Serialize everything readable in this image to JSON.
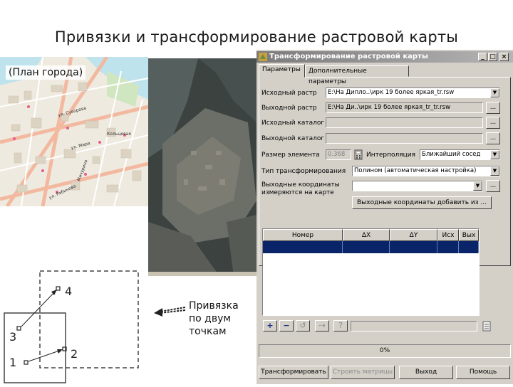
{
  "slide": {
    "title": "Привязки и трансформирование растровой карты",
    "map_label": "(План города)",
    "pointer_text": "Привязка\nпо двум\nточкам",
    "map_streets": [
      "ул. Суворова",
      "Кольцевая",
      "Мичурина",
      "ул. Рябинова",
      "ул. Мира"
    ]
  },
  "diagram": {
    "points": [
      "1",
      "2",
      "3",
      "4"
    ]
  },
  "dialog": {
    "title": "Трансформирование растровой карты",
    "controls": {
      "minimize": "_",
      "maximize": "□",
      "close": "×"
    },
    "tabs": [
      "Параметры",
      "Дополнительные параметры"
    ],
    "fields": {
      "source_raster": {
        "label": "Исходный растр",
        "value": "E:\\На Дипло..\\ирк 19 более яркая_tr.rsw"
      },
      "output_raster": {
        "label": "Выходной растр",
        "value": "E:\\На Ди..\\ирк 19 более яркая_tr_tr.rsw"
      },
      "source_catalog": {
        "label": "Исходный каталог",
        "value": ""
      },
      "output_catalog": {
        "label": "Выходной каталог",
        "value": ""
      },
      "element_size": {
        "label": "Размер элемента",
        "value": "0.368"
      },
      "interpolation": {
        "label": "Интерполяция",
        "value": "Ближайший сосед"
      },
      "transform_type": {
        "label": "Тип трансформирования",
        "value": "Полином (автоматическая настройка)"
      },
      "output_coords": {
        "label": "Выходные координаты измеряются на карте",
        "value": ""
      }
    },
    "browse_label": "...",
    "add_coords_button": "Выходные координаты добавить из ...",
    "table": {
      "columns": [
        "Номер",
        "ΔX",
        "ΔY",
        "Исх",
        "Вых"
      ]
    },
    "table_buttons": [
      "+",
      "−",
      "↺",
      "⇢",
      "?"
    ],
    "progress": "0%",
    "buttons": {
      "transform": "Трансформировать",
      "build_matrix": "Строить матрицы",
      "exit": "Выход",
      "help": "Помощь"
    }
  },
  "colors": {
    "dialog_bg": "#d4d0c8",
    "titlebar": "#8a8a8a",
    "selection": "#0a246a"
  }
}
